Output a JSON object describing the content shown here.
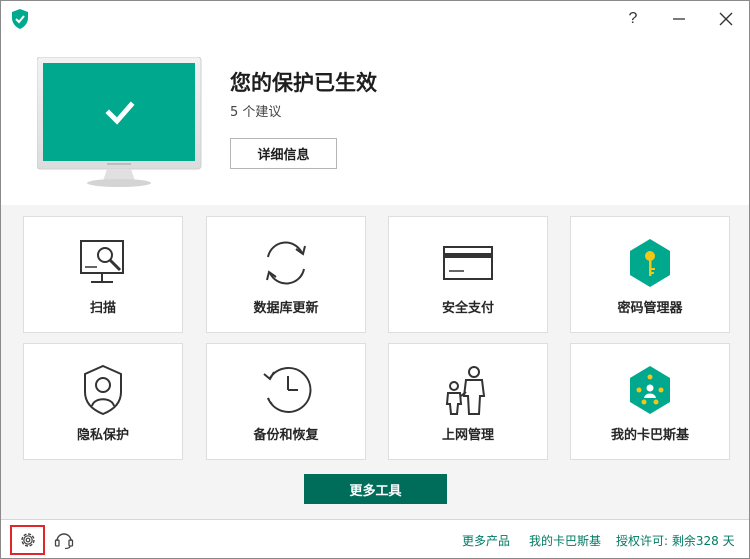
{
  "window": {
    "help_label": "?",
    "minimize_icon": "minimize-icon",
    "close_icon": "close-icon"
  },
  "status": {
    "title": "您的保护已生效",
    "recommendations": "5 个建议",
    "details_label": "详细信息"
  },
  "tiles": [
    {
      "label": "扫描",
      "icon": "scan-icon"
    },
    {
      "label": "数据库更新",
      "icon": "database-update-icon"
    },
    {
      "label": "安全支付",
      "icon": "safe-money-icon"
    },
    {
      "label": "密码管理器",
      "icon": "password-manager-icon"
    },
    {
      "label": "隐私保护",
      "icon": "privacy-protection-icon"
    },
    {
      "label": "备份和恢复",
      "icon": "backup-restore-icon"
    },
    {
      "label": "上网管理",
      "icon": "parental-control-icon"
    },
    {
      "label": "我的卡巴斯基",
      "icon": "my-kaspersky-icon"
    }
  ],
  "more_tools_label": "更多工具",
  "footer": {
    "more_products": "更多产品",
    "my_kaspersky": "我的卡巴斯基",
    "license": "授权许可: 剩余328 天"
  },
  "colors": {
    "accent": "#00a88e",
    "dark_accent": "#006d5b",
    "link": "#007a63",
    "highlight": "#e0262b"
  }
}
